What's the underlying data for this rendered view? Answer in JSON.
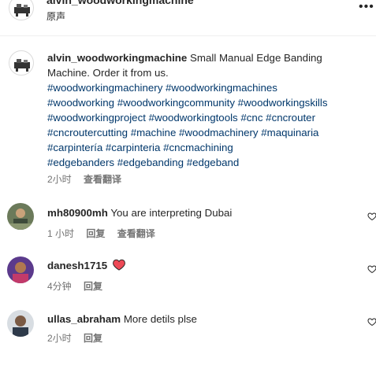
{
  "header": {
    "username": "alvin_woodworkingmachine",
    "audio": "原声",
    "more": "•••"
  },
  "caption": {
    "username": "alvin_woodworkingmachine",
    "text": "Small Manual Edge Banding Machine. Order it from us.",
    "hashtag_lines": [
      "#woodworkingmachinery #woodworkingmachines",
      "#woodworking #woodworkingcommunity #woodworkingskills",
      "#woodworkingproject #woodworkingtools #cnc #cncrouter",
      "#cncroutercutting #machine #woodmachinery #maquinaria",
      "#carpintería #carpinteria #cncmachining",
      "#edgebanders #edgebanding #edgeband"
    ],
    "time": "2小时",
    "translate": "查看翻译"
  },
  "comments": [
    {
      "username": "mh80900mh",
      "text": "You are interpreting Dubai",
      "time": "1 小时",
      "reply": "回复",
      "translate": "查看翻译"
    },
    {
      "username": "danesh1715",
      "text": "",
      "emoji": "heart",
      "time": "4分钟",
      "reply": "回复"
    },
    {
      "username": "ullas_abraham",
      "text": "More detils plse",
      "time": "2小时",
      "reply": "回复"
    }
  ],
  "colors": {
    "text": "#262626",
    "secondary": "#737373",
    "hashtag": "#00376b",
    "heart": "#ed4956",
    "divider": "#efefef"
  }
}
